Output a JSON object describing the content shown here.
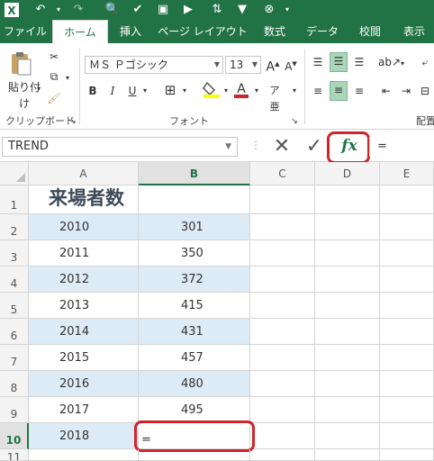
{
  "quick_access": {
    "icons": [
      "excel-logo-icon",
      "undo-icon",
      "redo-icon",
      "print-preview-icon",
      "spell-check-icon",
      "save-icon",
      "macro-icon",
      "sort-icon",
      "filter-icon",
      "clear-icon"
    ]
  },
  "tabs": [
    "ファイル",
    "ホーム",
    "挿入",
    "ページ レイアウト",
    "数式",
    "データ",
    "校閲",
    "表示"
  ],
  "active_tab": "ホーム",
  "ribbon": {
    "clipboard": {
      "paste_label": "貼り付け",
      "group_label": "クリップボード"
    },
    "font": {
      "font_name": "ＭＳ Ｐゴシック",
      "font_size": "13",
      "bold": "B",
      "italic": "I",
      "underline": "U",
      "group_label": "フォント",
      "fill_color": "#ffff00",
      "font_color": "#d0242b"
    },
    "alignment": {
      "group_label": "配置"
    }
  },
  "formula_bar": {
    "name_box": "TREND",
    "cancel_symbol": "✕",
    "enter_symbol": "✓",
    "fx_label": "fx",
    "formula": "="
  },
  "columns": [
    "A",
    "B",
    "C",
    "D",
    "E"
  ],
  "selected_column": "B",
  "rows": [
    {
      "num": "1",
      "a": "来場者数",
      "b": ""
    },
    {
      "num": "2",
      "a": "2010",
      "b": "301"
    },
    {
      "num": "3",
      "a": "2011",
      "b": "350"
    },
    {
      "num": "4",
      "a": "2012",
      "b": "372"
    },
    {
      "num": "5",
      "a": "2013",
      "b": "415"
    },
    {
      "num": "6",
      "a": "2014",
      "b": "431"
    },
    {
      "num": "7",
      "a": "2015",
      "b": "457"
    },
    {
      "num": "8",
      "a": "2016",
      "b": "480"
    },
    {
      "num": "9",
      "a": "2017",
      "b": "495"
    },
    {
      "num": "10",
      "a": "2018",
      "b": "="
    },
    {
      "num": "11",
      "a": "",
      "b": ""
    }
  ],
  "selected_row": "10",
  "colors": {
    "excel_green": "#217346",
    "band_blue": "#ddebf7",
    "highlight_red": "#d0242b"
  }
}
